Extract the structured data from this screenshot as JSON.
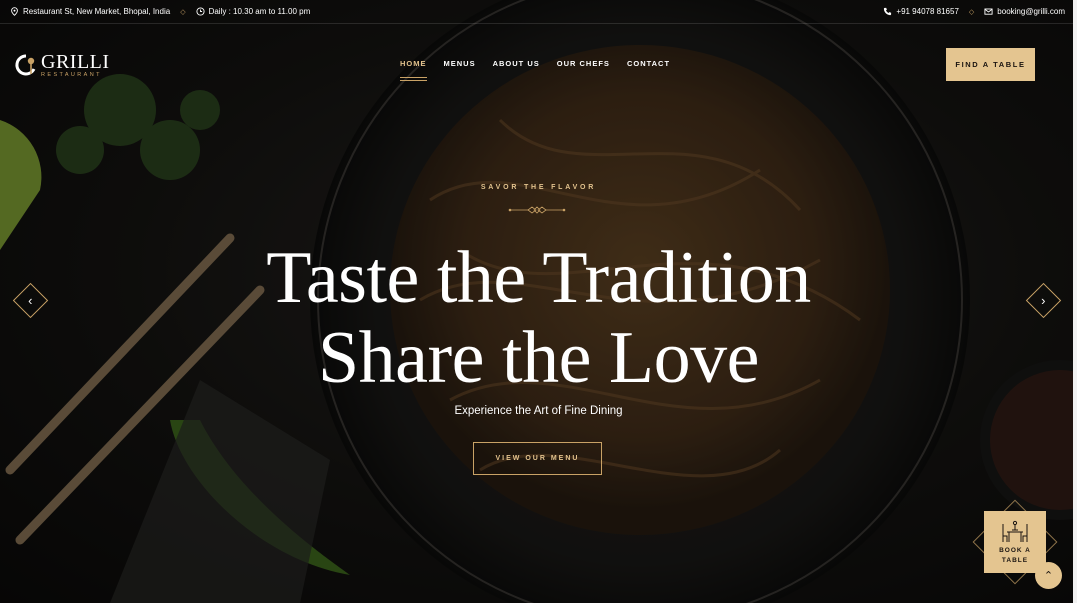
{
  "topbar": {
    "address": "Restaurant St, New Market, Bhopal, India",
    "hours": "Daily : 10.30 am to 11.00 pm",
    "phone": "+91 94078 81657",
    "email": "booking@grilli.com"
  },
  "logo": {
    "brand": "GRILLI",
    "sub": "RESTAURANT"
  },
  "nav": {
    "items": [
      {
        "label": "HOME",
        "active": true
      },
      {
        "label": "MENUS"
      },
      {
        "label": "ABOUT US"
      },
      {
        "label": "OUR CHEFS"
      },
      {
        "label": "CONTACT"
      }
    ]
  },
  "header": {
    "cta_label": "FIND A TABLE"
  },
  "hero": {
    "eyebrow": "SAVOR THE FLAVOR",
    "title_line1": "Taste the Tradition",
    "title_line2": "Share the Love",
    "subtitle": "Experience the Art of Fine Dining",
    "cta_label": "VIEW OUR MENU"
  },
  "book_badge": {
    "line1": "BOOK A",
    "line2": "TABLE"
  },
  "colors": {
    "accent": "#e4c590",
    "gold_line": "#c9a266",
    "bg": "#0e0d0c"
  }
}
